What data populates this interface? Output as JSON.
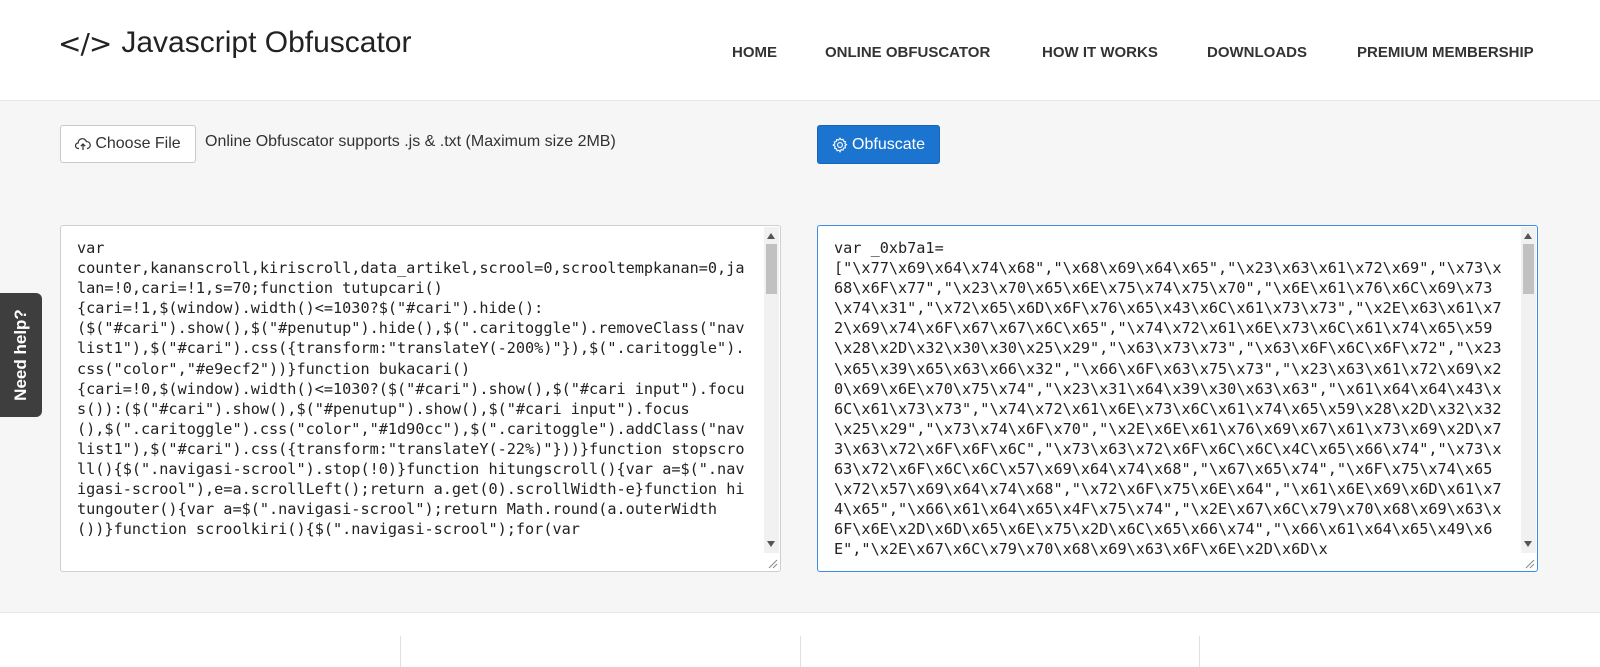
{
  "header": {
    "logo_icon": "</>",
    "title": "Javascript Obfuscator",
    "nav": [
      {
        "label": "HOME"
      },
      {
        "label": "ONLINE OBFUSCATOR"
      },
      {
        "label": "HOW IT WORKS"
      },
      {
        "label": "DOWNLOADS"
      },
      {
        "label": "PREMIUM MEMBERSHIP"
      }
    ]
  },
  "toolbar": {
    "choose_file_label": "Choose File",
    "choose_file_icon": "cloud-upload-icon",
    "support_text": "Online Obfuscator supports .js & .txt (Maximum size 2MB)",
    "obfuscate_label": "Obfuscate",
    "obfuscate_icon": "gear-icon"
  },
  "input_code": "var\ncounter,kananscroll,kiriscroll,data_artikel,scrool=0,scrooltempkanan=0,jalan=!0,cari=!1,s=70;function tutupcari()\n{cari=!1,$(window).width()<=1030?$(\"#cari\").hide():\n($(\"#cari\").show(),$(\"#penutup\").hide(),$(\".caritoggle\").removeClass(\"navlist1\"),$(\"#cari\").css({transform:\"translateY(-200%)\"}),$(\".caritoggle\").css(\"color\",\"#e9ecf2\"))}function bukacari()\n{cari=!0,$(window).width()<=1030?($(\"#cari\").show(),$(\"#cari input\").focus()):($(\"#cari\").show(),$(\"#penutup\").show(),$(\"#cari input\").focus(),$(\".caritoggle\").css(\"color\",\"#1d90cc\"),$(\".caritoggle\").addClass(\"navlist1\"),$(\"#cari\").css({transform:\"translateY(-22%)\"}))}function stopscroll(){$(\".navigasi-scrool\").stop(!0)}function hitungscroll(){var a=$(\".navigasi-scrool\"),e=a.scrollLeft();return a.get(0).scrollWidth-e}function hitungouter(){var a=$(\".navigasi-scrool\");return Math.round(a.outerWidth())}function scroolkiri(){$(\".navigasi-scrool\");for(var",
  "output_code": "var _0xb7a1=\n[\"\\x77\\x69\\x64\\x74\\x68\",\"\\x68\\x69\\x64\\x65\",\"\\x23\\x63\\x61\\x72\\x69\",\"\\x73\\x68\\x6F\\x77\",\"\\x23\\x70\\x65\\x6E\\x75\\x74\\x75\\x70\",\"\\x6E\\x61\\x76\\x6C\\x69\\x73\\x74\\x31\",\"\\x72\\x65\\x6D\\x6F\\x76\\x65\\x43\\x6C\\x61\\x73\\x73\",\"\\x2E\\x63\\x61\\x72\\x69\\x74\\x6F\\x67\\x67\\x6C\\x65\",\"\\x74\\x72\\x61\\x6E\\x73\\x6C\\x61\\x74\\x65\\x59\\x28\\x2D\\x32\\x30\\x30\\x25\\x29\",\"\\x63\\x73\\x73\",\"\\x63\\x6F\\x6C\\x6F\\x72\",\"\\x23\\x65\\x39\\x65\\x63\\x66\\x32\",\"\\x66\\x6F\\x63\\x75\\x73\",\"\\x23\\x63\\x61\\x72\\x69\\x20\\x69\\x6E\\x70\\x75\\x74\",\"\\x23\\x31\\x64\\x39\\x30\\x63\\x63\",\"\\x61\\x64\\x64\\x43\\x6C\\x61\\x73\\x73\",\"\\x74\\x72\\x61\\x6E\\x73\\x6C\\x61\\x74\\x65\\x59\\x28\\x2D\\x32\\x32\\x25\\x29\",\"\\x73\\x74\\x6F\\x70\",\"\\x2E\\x6E\\x61\\x76\\x69\\x67\\x61\\x73\\x69\\x2D\\x73\\x63\\x72\\x6F\\x6F\\x6C\",\"\\x73\\x63\\x72\\x6F\\x6C\\x6C\\x4C\\x65\\x66\\x74\",\"\\x73\\x63\\x72\\x6F\\x6C\\x6C\\x57\\x69\\x64\\x74\\x68\",\"\\x67\\x65\\x74\",\"\\x6F\\x75\\x74\\x65\\x72\\x57\\x69\\x64\\x74\\x68\",\"\\x72\\x6F\\x75\\x6E\\x64\",\"\\x61\\x6E\\x69\\x6D\\x61\\x74\\x65\",\"\\x66\\x61\\x64\\x65\\x4F\\x75\\x74\",\"\\x2E\\x67\\x6C\\x79\\x70\\x68\\x69\\x63\\x6F\\x6E\\x2D\\x6D\\x65\\x6E\\x75\\x2D\\x6C\\x65\\x66\\x74\",\"\\x66\\x61\\x64\\x65\\x49\\x6E\",\"\\x2E\\x67\\x6C\\x79\\x70\\x68\\x69\\x63\\x6F\\x6E\\x2D\\x6D\\x",
  "help": {
    "label": "Need help?"
  }
}
